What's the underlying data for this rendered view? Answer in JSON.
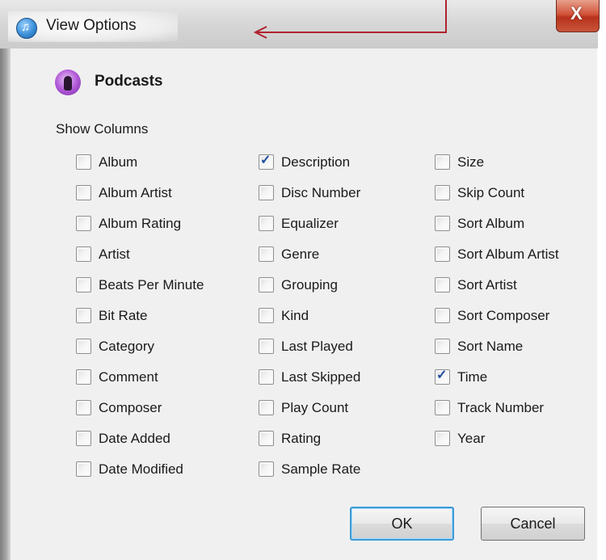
{
  "window": {
    "title": "View Options",
    "close_glyph": "X",
    "app_icon": "itunes-icon"
  },
  "section": {
    "icon": "podcast-icon",
    "title": "Podcasts"
  },
  "show_columns_label": "Show Columns",
  "columns": [
    [
      {
        "label": "Album",
        "checked": false
      },
      {
        "label": "Album Artist",
        "checked": false
      },
      {
        "label": "Album Rating",
        "checked": false
      },
      {
        "label": "Artist",
        "checked": false
      },
      {
        "label": "Beats Per Minute",
        "checked": false
      },
      {
        "label": "Bit Rate",
        "checked": false
      },
      {
        "label": "Category",
        "checked": false
      },
      {
        "label": "Comment",
        "checked": false
      },
      {
        "label": "Composer",
        "checked": false
      },
      {
        "label": "Date Added",
        "checked": false
      },
      {
        "label": "Date Modified",
        "checked": false
      }
    ],
    [
      {
        "label": "Description",
        "checked": true
      },
      {
        "label": "Disc Number",
        "checked": false
      },
      {
        "label": "Equalizer",
        "checked": false
      },
      {
        "label": "Genre",
        "checked": false
      },
      {
        "label": "Grouping",
        "checked": false
      },
      {
        "label": "Kind",
        "checked": false
      },
      {
        "label": "Last Played",
        "checked": false
      },
      {
        "label": "Last Skipped",
        "checked": false
      },
      {
        "label": "Play Count",
        "checked": false
      },
      {
        "label": "Rating",
        "checked": false
      },
      {
        "label": "Sample Rate",
        "checked": false
      }
    ],
    [
      {
        "label": "Size",
        "checked": false
      },
      {
        "label": "Skip Count",
        "checked": false
      },
      {
        "label": "Sort Album",
        "checked": false
      },
      {
        "label": "Sort Album Artist",
        "checked": false
      },
      {
        "label": "Sort Artist",
        "checked": false
      },
      {
        "label": "Sort Composer",
        "checked": false
      },
      {
        "label": "Sort Name",
        "checked": false
      },
      {
        "label": "Time",
        "checked": true
      },
      {
        "label": "Track Number",
        "checked": false
      },
      {
        "label": "Year",
        "checked": false
      }
    ]
  ],
  "buttons": {
    "ok_label": "OK",
    "cancel_label": "Cancel"
  },
  "colors": {
    "check_mark": "#1f4e9b",
    "annotation_arrow": "#b0212f",
    "default_button_border": "#3c9ad6"
  }
}
